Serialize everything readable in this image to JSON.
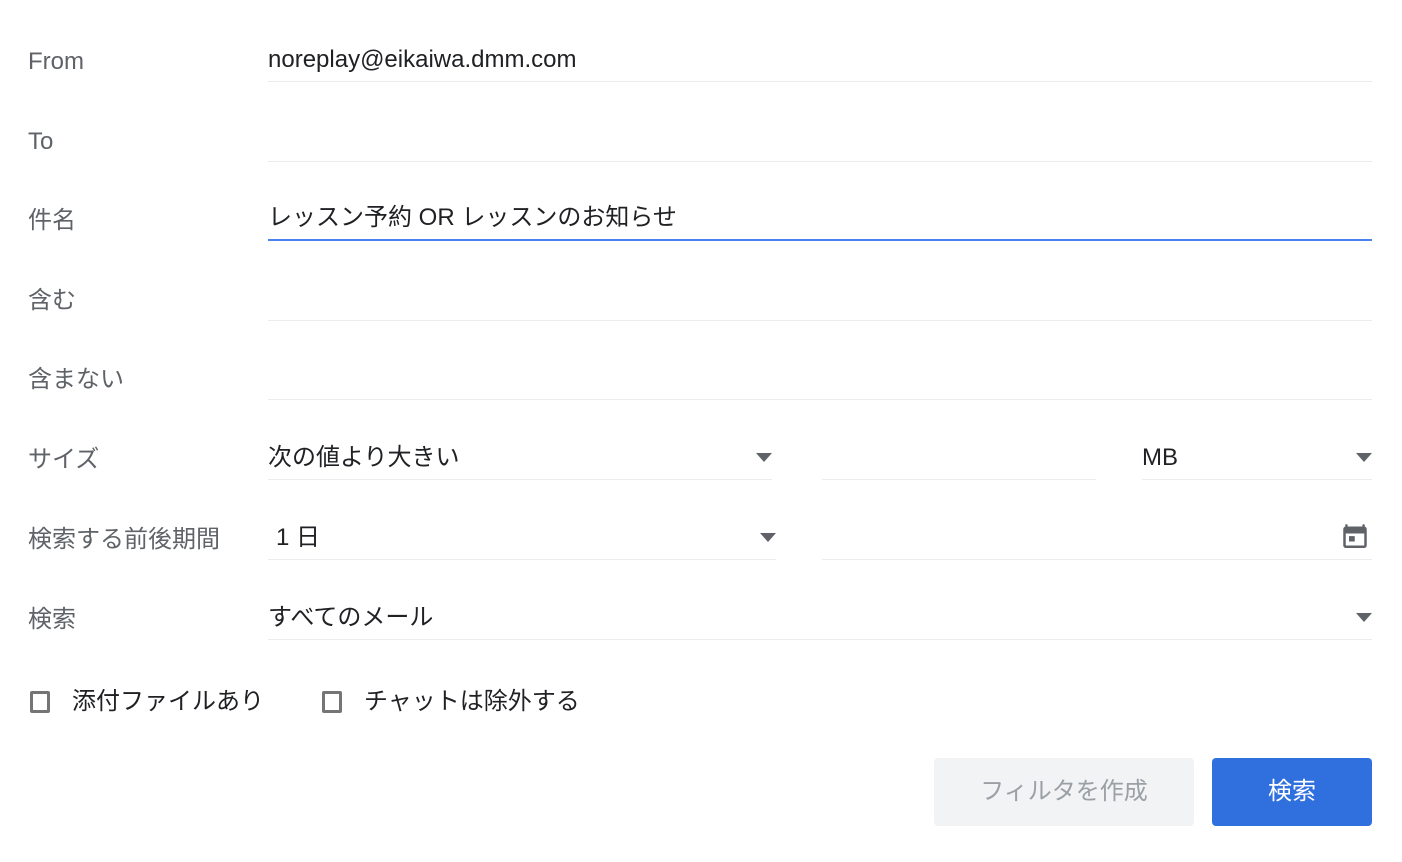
{
  "dialog": {
    "accent_blue": "#4b81f0",
    "button_blue": "#2f6fde",
    "underline_gray": "#ececec",
    "label_gray": "#5f6368"
  },
  "fields": {
    "from": {
      "label": "From",
      "value": "noreplay@eikaiwa.dmm.com",
      "placeholder": ""
    },
    "to": {
      "label": "To",
      "value": "",
      "placeholder": ""
    },
    "subject": {
      "label": "件名",
      "value": "レッスン予約 OR レッスンのお知らせ",
      "placeholder": ""
    },
    "includes": {
      "label": "含む",
      "value": "",
      "placeholder": ""
    },
    "excludes": {
      "label": "含まない",
      "value": "",
      "placeholder": ""
    },
    "size": {
      "label": "サイズ",
      "comparator": "次の値より大きい",
      "amount": "",
      "amount_placeholder": "",
      "unit": "MB"
    },
    "date_range": {
      "label": "検索する前後期間",
      "window": "1 日",
      "date_value": "",
      "date_placeholder": "",
      "calendar_icon": "calendar-icon"
    },
    "scope": {
      "label": "検索",
      "value": "すべてのメール"
    }
  },
  "checkboxes": [
    {
      "label": "添付ファイルあり",
      "checked": false
    },
    {
      "label": "チャットは除外する",
      "checked": false
    }
  ],
  "actions": {
    "create_filter_label": "フィルタを作成",
    "search_label": "検索"
  },
  "icons": {
    "caret": "chevron-down-icon"
  }
}
